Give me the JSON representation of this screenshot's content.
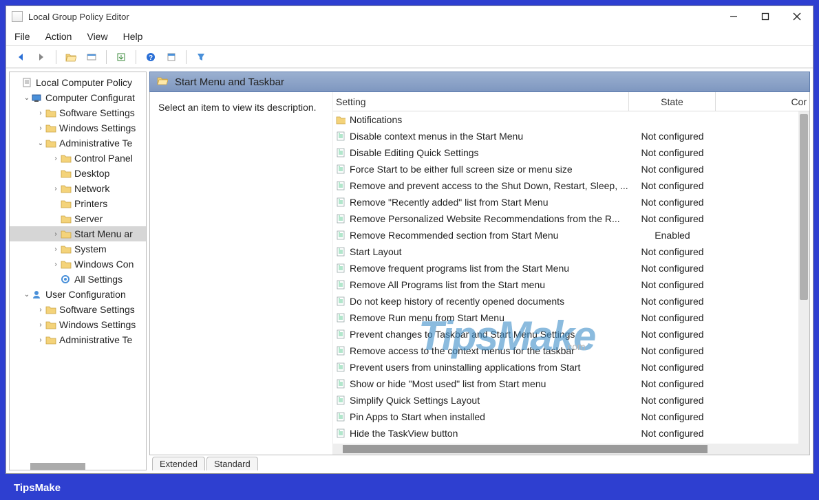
{
  "window": {
    "title": "Local Group Policy Editor"
  },
  "menubar": [
    "File",
    "Action",
    "View",
    "Help"
  ],
  "header": {
    "title": "Start Menu and Taskbar",
    "description_hint": "Select an item to view its description."
  },
  "columns": {
    "setting": "Setting",
    "state": "State",
    "comment": "Cor"
  },
  "tree": [
    {
      "level": 0,
      "label": "Local Computer Policy",
      "icon": "doc",
      "expander": ""
    },
    {
      "level": 1,
      "label": "Computer Configurat",
      "icon": "computer",
      "expander": "v"
    },
    {
      "level": 2,
      "label": "Software Settings",
      "icon": "folder",
      "expander": ">"
    },
    {
      "level": 2,
      "label": "Windows Settings",
      "icon": "folder",
      "expander": ">"
    },
    {
      "level": 2,
      "label": "Administrative Te",
      "icon": "folder",
      "expander": "v"
    },
    {
      "level": 3,
      "label": "Control Panel",
      "icon": "folder",
      "expander": ">"
    },
    {
      "level": 3,
      "label": "Desktop",
      "icon": "folder",
      "expander": ""
    },
    {
      "level": 3,
      "label": "Network",
      "icon": "folder",
      "expander": ">"
    },
    {
      "level": 3,
      "label": "Printers",
      "icon": "folder",
      "expander": ""
    },
    {
      "level": 3,
      "label": "Server",
      "icon": "folder",
      "expander": ""
    },
    {
      "level": 3,
      "label": "Start Menu ar",
      "icon": "folder",
      "expander": ">",
      "selected": true
    },
    {
      "level": 3,
      "label": "System",
      "icon": "folder",
      "expander": ">"
    },
    {
      "level": 3,
      "label": "Windows Con",
      "icon": "folder",
      "expander": ">"
    },
    {
      "level": 3,
      "label": "All Settings",
      "icon": "settings",
      "expander": ""
    },
    {
      "level": 1,
      "label": "User Configuration",
      "icon": "user",
      "expander": "v"
    },
    {
      "level": 2,
      "label": "Software Settings",
      "icon": "folder",
      "expander": ">"
    },
    {
      "level": 2,
      "label": "Windows Settings",
      "icon": "folder",
      "expander": ">"
    },
    {
      "level": 2,
      "label": "Administrative Te",
      "icon": "folder",
      "expander": ">"
    }
  ],
  "rows": [
    {
      "icon": "folder",
      "setting": "Notifications",
      "state": ""
    },
    {
      "icon": "policy",
      "setting": "Disable context menus in the Start Menu",
      "state": "Not configured"
    },
    {
      "icon": "policy",
      "setting": "Disable Editing Quick Settings",
      "state": "Not configured"
    },
    {
      "icon": "policy",
      "setting": "Force Start to be either full screen size or menu size",
      "state": "Not configured"
    },
    {
      "icon": "policy",
      "setting": "Remove and prevent access to the Shut Down, Restart, Sleep, ...",
      "state": "Not configured"
    },
    {
      "icon": "policy",
      "setting": "Remove \"Recently added\" list from Start Menu",
      "state": "Not configured"
    },
    {
      "icon": "policy",
      "setting": "Remove Personalized Website Recommendations from the R...",
      "state": "Not configured"
    },
    {
      "icon": "policy",
      "setting": "Remove Recommended section from Start Menu",
      "state": "Enabled"
    },
    {
      "icon": "policy",
      "setting": "Start Layout",
      "state": "Not configured"
    },
    {
      "icon": "policy",
      "setting": "Remove frequent programs list from the Start Menu",
      "state": "Not configured"
    },
    {
      "icon": "policy",
      "setting": "Remove All Programs list from the Start menu",
      "state": "Not configured"
    },
    {
      "icon": "policy",
      "setting": "Do not keep history of recently opened documents",
      "state": "Not configured"
    },
    {
      "icon": "policy",
      "setting": "Remove Run menu from Start Menu",
      "state": "Not configured"
    },
    {
      "icon": "policy",
      "setting": "Prevent changes to Taskbar and Start Menu Settings",
      "state": "Not configured"
    },
    {
      "icon": "policy",
      "setting": "Remove access to the context menus for the taskbar",
      "state": "Not configured"
    },
    {
      "icon": "policy",
      "setting": "Prevent users from uninstalling applications from Start",
      "state": "Not configured"
    },
    {
      "icon": "policy",
      "setting": "Show or hide \"Most used\" list from Start menu",
      "state": "Not configured"
    },
    {
      "icon": "policy",
      "setting": "Simplify Quick Settings Layout",
      "state": "Not configured"
    },
    {
      "icon": "policy",
      "setting": "Pin Apps to Start when installed",
      "state": "Not configured"
    },
    {
      "icon": "policy",
      "setting": "Hide the TaskView button",
      "state": "Not configured"
    }
  ],
  "tabs": {
    "extended": "Extended",
    "standard": "Standard"
  },
  "footer": {
    "brand": "TipsMake"
  },
  "watermark": {
    "main": "TipsMake",
    "sub": ".com"
  }
}
